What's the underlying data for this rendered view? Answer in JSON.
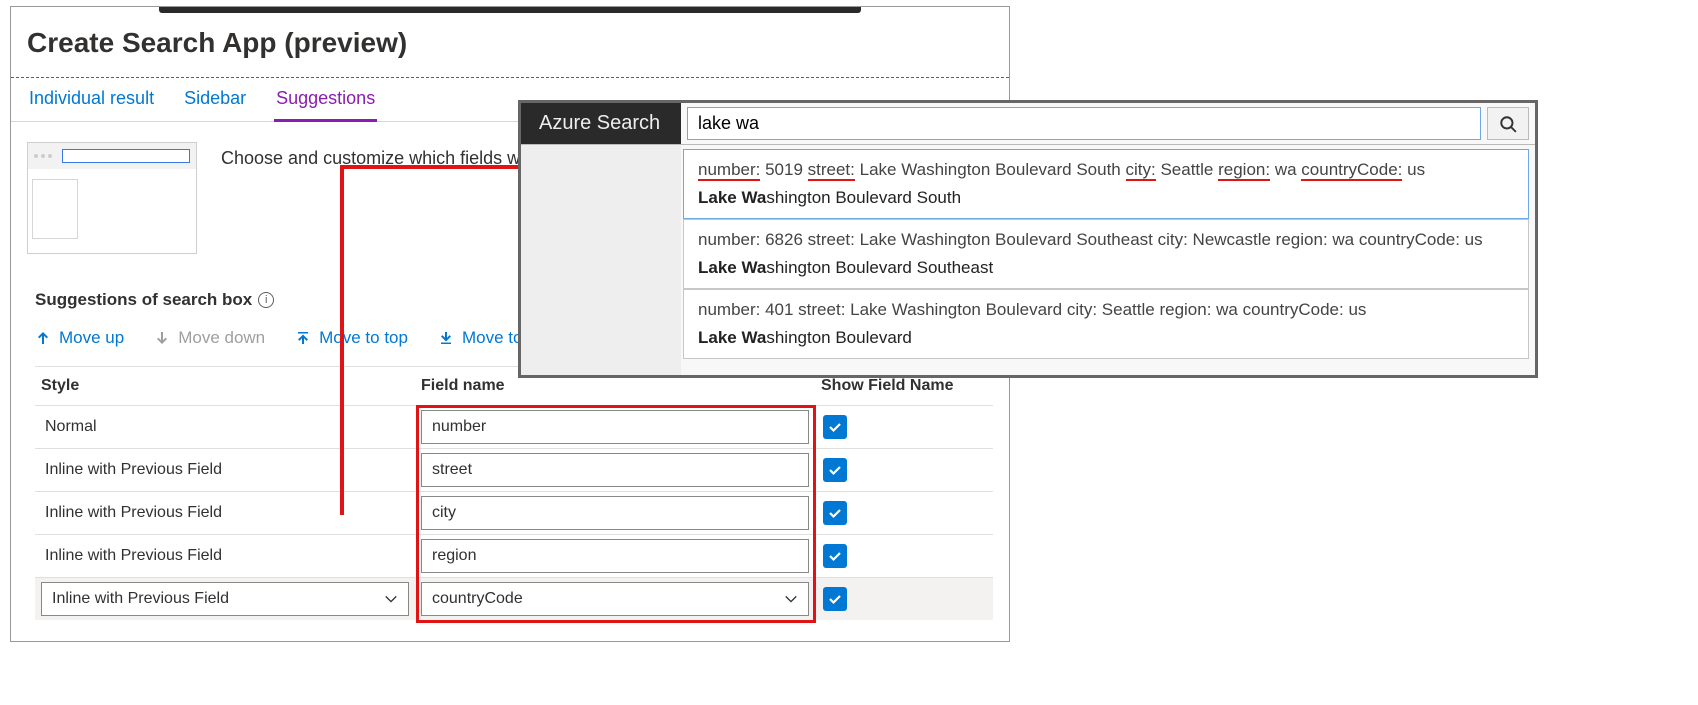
{
  "page": {
    "title": "Create Search App (preview)"
  },
  "tabs": {
    "individual": "Individual result",
    "sidebar": "Sidebar",
    "suggestions": "Suggestions"
  },
  "description": "Choose and customize which fields will",
  "section": {
    "heading": "Suggestions of search box"
  },
  "toolbar": {
    "move_up": "Move up",
    "move_down": "Move down",
    "move_to_top": "Move to top",
    "move_to": "Move to"
  },
  "grid": {
    "headers": {
      "style": "Style",
      "field_name": "Field name",
      "show_field": "Show Field Name"
    },
    "rows": [
      {
        "style": "Normal",
        "field": "number",
        "checked": true,
        "selected": false,
        "style_editable": false
      },
      {
        "style": "Inline with Previous Field",
        "field": "street",
        "checked": true,
        "selected": false,
        "style_editable": false
      },
      {
        "style": "Inline with Previous Field",
        "field": "city",
        "checked": true,
        "selected": false,
        "style_editable": false
      },
      {
        "style": "Inline with Previous Field",
        "field": "region",
        "checked": true,
        "selected": false,
        "style_editable": false
      },
      {
        "style": "Inline with Previous Field",
        "field": "countryCode",
        "checked": true,
        "selected": true,
        "style_editable": true
      }
    ]
  },
  "search": {
    "brand": "Azure Search",
    "query": "lake wa",
    "suggestions": [
      {
        "line1": "number: 5019 street: Lake Washington Boulevard South city: Seattle region: wa countryCode: us",
        "line2_bold": "Lake Wa",
        "line2_rest": "shington Boulevard South",
        "underline_labels": true
      },
      {
        "line1": "number: 6826 street: Lake Washington Boulevard Southeast city: Newcastle region: wa countryCode: us",
        "line2_bold": "Lake Wa",
        "line2_rest": "shington Boulevard Southeast",
        "underline_labels": false
      },
      {
        "line1": "number: 401 street: Lake Washington Boulevard city: Seattle region: wa countryCode: us",
        "line2_bold": "Lake Wa",
        "line2_rest": "shington Boulevard",
        "underline_labels": false
      }
    ]
  }
}
